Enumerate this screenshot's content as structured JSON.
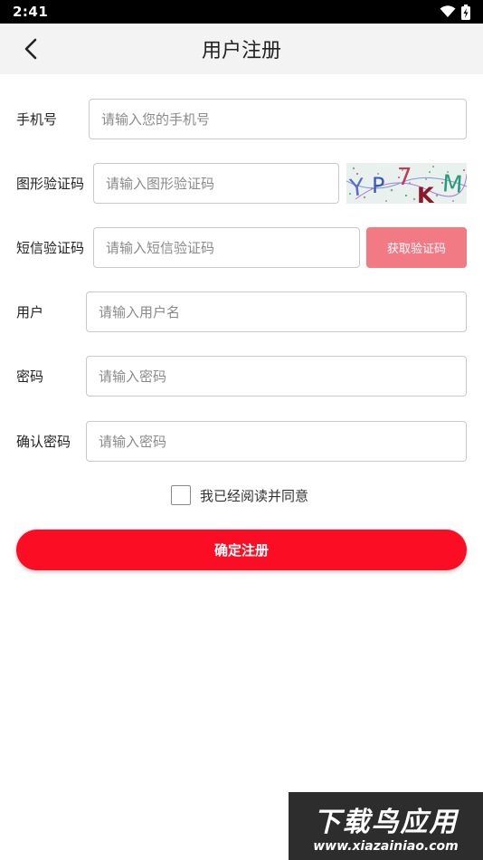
{
  "status_bar": {
    "time": "2:41"
  },
  "header": {
    "title": "用户注册"
  },
  "form": {
    "phone": {
      "label": "手机号",
      "placeholder": "请输入您的手机号"
    },
    "image_code": {
      "label": "图形验证码",
      "placeholder": "请输入图形验证码",
      "captcha_text": "YP7KM"
    },
    "sms_code": {
      "label": "短信验证码",
      "placeholder": "请输入短信验证码",
      "button_label": "获取验证码"
    },
    "username": {
      "label": "用户",
      "placeholder": "请输入用户名"
    },
    "password": {
      "label": "密码",
      "placeholder": "请输入密码"
    },
    "confirm_password": {
      "label": "确认密码",
      "placeholder": "请输入密码"
    },
    "agreement": {
      "text": "我已经阅读并同意",
      "checked": false
    },
    "submit_label": "确定注册"
  },
  "watermark": {
    "title": "下载鸟应用",
    "url": "www.xiazainiao.com"
  },
  "colors": {
    "accent": "#fb0d24",
    "sms_button": "#f27a85",
    "header_bg": "#f3f3f3"
  }
}
